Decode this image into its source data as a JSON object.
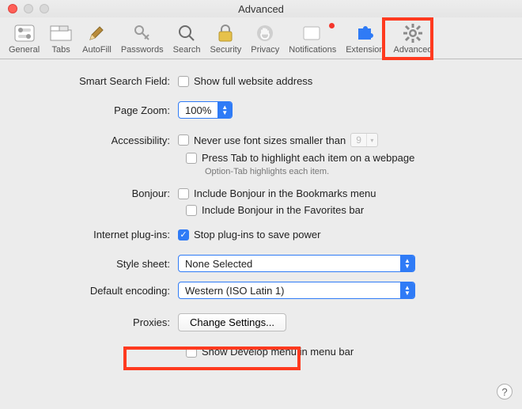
{
  "window": {
    "title": "Advanced"
  },
  "toolbar": {
    "items": [
      {
        "id": "general",
        "label": "General"
      },
      {
        "id": "tabs",
        "label": "Tabs"
      },
      {
        "id": "autofill",
        "label": "AutoFill"
      },
      {
        "id": "passwords",
        "label": "Passwords"
      },
      {
        "id": "search",
        "label": "Search"
      },
      {
        "id": "security",
        "label": "Security"
      },
      {
        "id": "privacy",
        "label": "Privacy"
      },
      {
        "id": "notifications",
        "label": "Notifications",
        "badge": true
      },
      {
        "id": "extensions",
        "label": "Extension"
      },
      {
        "id": "advanced",
        "label": "Advanced",
        "selected": true,
        "highlight": true
      }
    ]
  },
  "sections": {
    "smart_search": {
      "label": "Smart Search Field:",
      "show_full_url": {
        "checked": false,
        "text": "Show full website address"
      }
    },
    "page_zoom": {
      "label": "Page Zoom:",
      "value": "100%"
    },
    "accessibility": {
      "label": "Accessibility:",
      "min_font": {
        "checked": false,
        "text": "Never use font sizes smaller than",
        "value": "9"
      },
      "tab_highlight": {
        "checked": false,
        "text": "Press Tab to highlight each item on a webpage"
      },
      "hint": "Option-Tab highlights each item."
    },
    "bonjour": {
      "label": "Bonjour:",
      "bookmarks": {
        "checked": false,
        "text": "Include Bonjour in the Bookmarks menu"
      },
      "favorites": {
        "checked": false,
        "text": "Include Bonjour in the Favorites bar"
      }
    },
    "plugins": {
      "label": "Internet plug-ins:",
      "stop_power": {
        "checked": true,
        "text": "Stop plug-ins to save power"
      }
    },
    "stylesheet": {
      "label": "Style sheet:",
      "value": "None Selected"
    },
    "encoding": {
      "label": "Default encoding:",
      "value": "Western (ISO Latin 1)"
    },
    "proxies": {
      "label": "Proxies:",
      "button": "Change Settings...",
      "highlight": true
    },
    "develop": {
      "checked": false,
      "text": "Show Develop menu in menu bar"
    }
  }
}
